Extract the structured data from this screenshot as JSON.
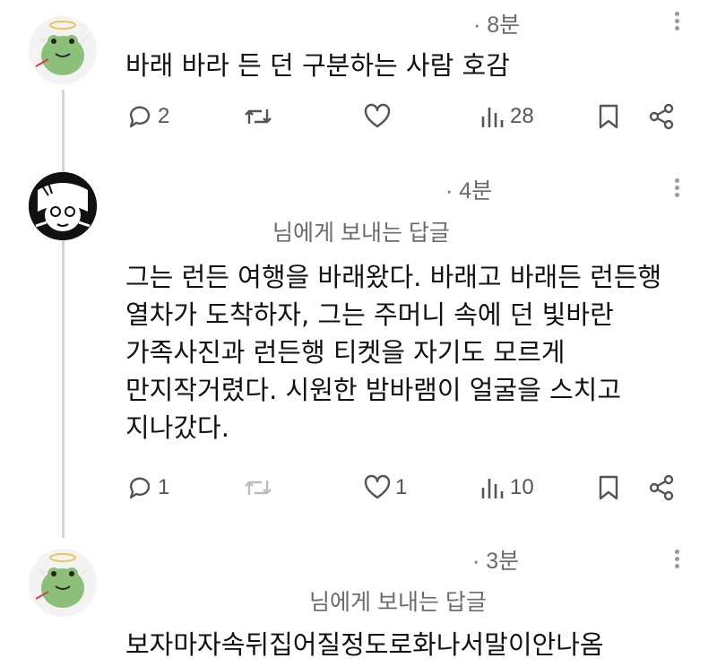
{
  "posts": [
    {
      "time": "· 8분",
      "reply_to": "",
      "text": "바래 바라 든 던 구분하는 사람 호감",
      "actions": {
        "replies": "2",
        "retweets": "",
        "likes": "",
        "views": "28"
      },
      "avatar": "frog-angel-avatar"
    },
    {
      "time": "· 4분",
      "reply_to": "님에게 보내는 답글",
      "text_lines": [
        "그는 런든 여행을 바래왔다. 바래고 바래든 런든행",
        "열차가 도착하자, 그는 주머니 속에 던 빛바란",
        "가족사진과 런든행 티켓을 자기도 모르게",
        "만지작거렸다. 시원한 밤바램이 얼굴을 스치고",
        "지나갔다."
      ],
      "actions": {
        "replies": "1",
        "retweets": "",
        "likes": "1",
        "views": "10"
      },
      "avatar": "manga-face-avatar"
    },
    {
      "time": "· 3분",
      "reply_to": "님에게 보내는 답글",
      "text": "보자마자속뒤집어질정도로화나서말이안나옴",
      "avatar": "frog-angel-avatar"
    }
  ],
  "icons": {
    "reply": "reply-icon",
    "retweet": "retweet-icon",
    "like": "heart-icon",
    "views": "views-icon",
    "bookmark": "bookmark-icon",
    "share": "share-icon",
    "more": "more-icon"
  },
  "colors": {
    "muted": "#6b6b6b",
    "icon": "#555555",
    "thread": "#d4d4d4"
  }
}
